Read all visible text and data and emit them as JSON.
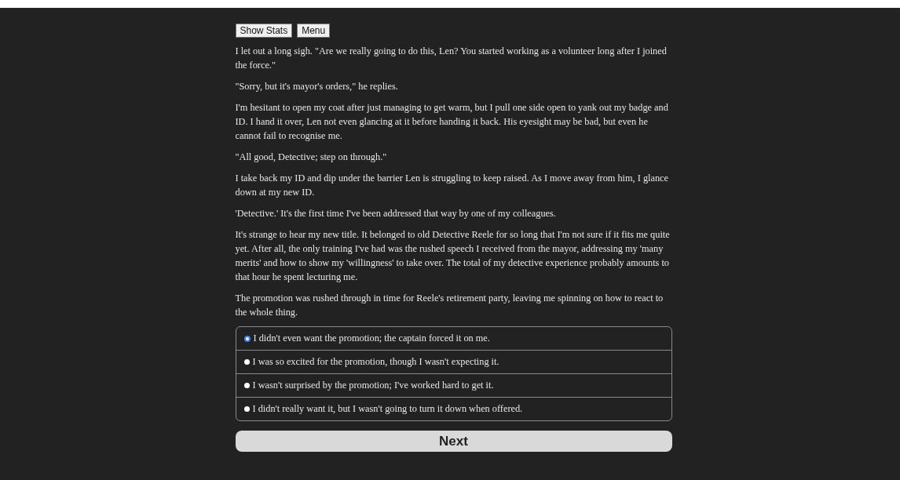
{
  "toolbar": [
    {
      "label": "Show Stats"
    },
    {
      "label": "Menu"
    }
  ],
  "paragraphs": [
    "I let out a long sigh. \"Are we really going to do this, Len? You started working as a volunteer long after I joined the force.\"",
    "\"Sorry, but it's mayor's orders,\" he replies.",
    "I'm hesitant to open my coat after just managing to get warm, but I pull one side open to yank out my badge and ID. I hand it over, Len not even glancing at it before handing it back. His eyesight may be bad, but even he cannot fail to recognise me.",
    "\"All good, Detective; step on through.\"",
    "I take back my ID and dip under the barrier Len is struggling to keep raised. As I move away from him, I glance down at my new ID.",
    "'Detective.' It's the first time I've been addressed that way by one of my colleagues.",
    "It's strange to hear my new title. It belonged to old Detective Reele for so long that I'm not sure if it fits me quite yet. After all, the only training I've had was the rushed speech I received from the mayor, addressing my 'many merits' and how to show my 'willingness' to take over. The total of my detective experience probably amounts to that hour he spent lecturing me.",
    "The promotion was rushed through in time for Reele's retirement party, leaving me spinning on how to react to the whole thing."
  ],
  "choices": [
    {
      "label": "I didn't even want the promotion; the captain forced it on me.",
      "selected": true
    },
    {
      "label": "I was so excited for the promotion, though I wasn't expecting it.",
      "selected": false
    },
    {
      "label": "I wasn't surprised by the promotion; I've worked hard to get it.",
      "selected": false
    },
    {
      "label": "I didn't really want it, but I wasn't going to turn it down when offered.",
      "selected": false
    }
  ],
  "next_button": {
    "label": "Next"
  }
}
